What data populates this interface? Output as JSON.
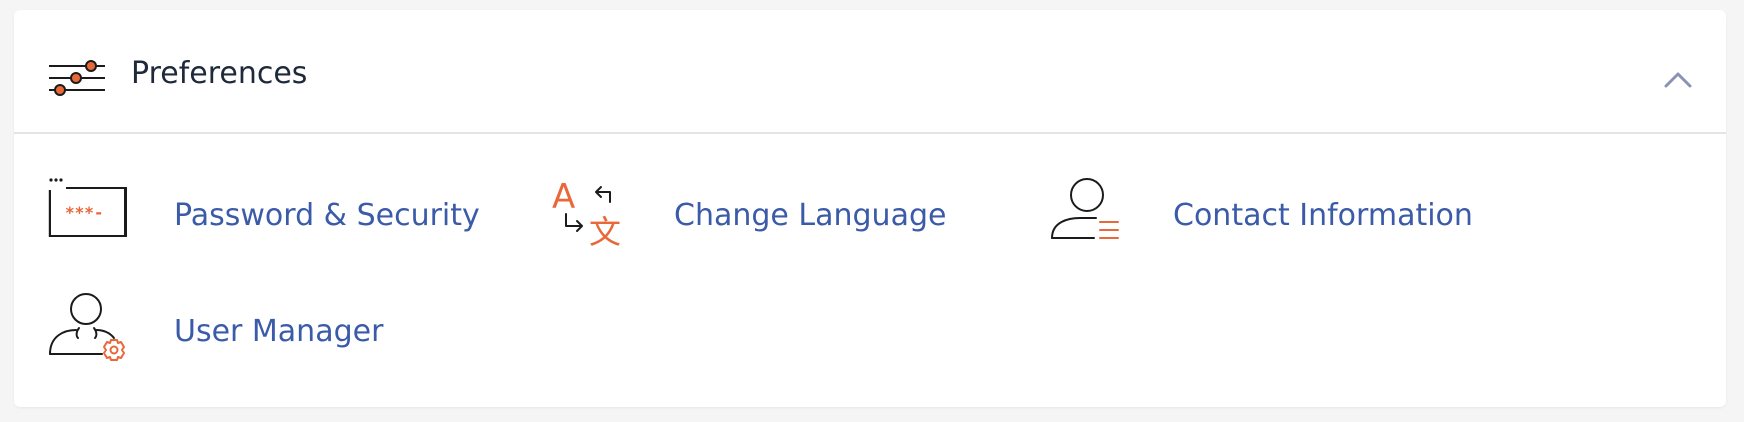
{
  "section": {
    "title": "Preferences",
    "icon": "sliders-icon",
    "toggle_icon": "chevron-up-icon",
    "expanded": true
  },
  "items": [
    {
      "label": "Password & Security",
      "icon": "password-field-icon"
    },
    {
      "label": "Change Language",
      "icon": "translate-icon"
    },
    {
      "label": "Contact Information",
      "icon": "contact-user-icon"
    },
    {
      "label": "User Manager",
      "icon": "user-gear-icon"
    }
  ],
  "colors": {
    "link": "#3b5ba9",
    "accent": "#e8683a",
    "title": "#1e2a3a",
    "divider": "#e2e4e7",
    "chevron": "#8a93b3"
  }
}
